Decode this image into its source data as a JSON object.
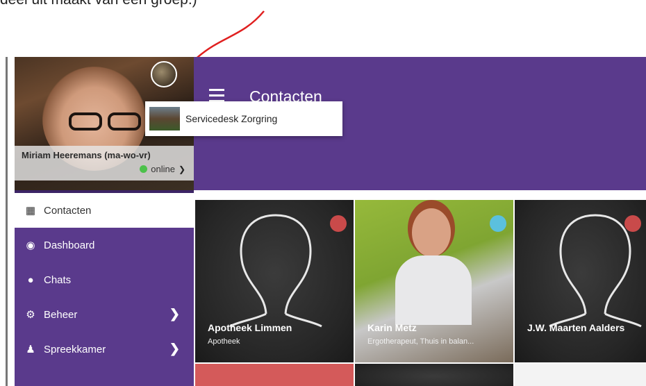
{
  "caption": "deel uit maakt van een groep.)",
  "profile": {
    "name": "Miriam Heeremans (ma-wo-vr)",
    "status": "online"
  },
  "dropdown": {
    "label": "Servicedesk Zorgring"
  },
  "header": {
    "title": "Contacten"
  },
  "menu": [
    {
      "label": "Contacten",
      "icon": "contacts-icon"
    },
    {
      "label": "Dashboard",
      "icon": "dashboard-icon"
    },
    {
      "label": "Chats",
      "icon": "chat-icon"
    },
    {
      "label": "Beheer",
      "icon": "gears-icon"
    },
    {
      "label": "Spreekkamer",
      "icon": "user-tie-icon"
    }
  ],
  "contacts": [
    {
      "name": "Apotheek Limmen",
      "role": "Apotheek",
      "status_color": "#c94a4a"
    },
    {
      "name": "Karin Metz",
      "role": "Ergotherapeut, Thuis in balan...",
      "status_color": "#5bc0de"
    },
    {
      "name": "J.W. Maarten Aalders",
      "role": "",
      "status_color": "#c94a4a"
    }
  ],
  "colors": {
    "brand": "#5a3a8c",
    "online": "#4cc14a"
  }
}
